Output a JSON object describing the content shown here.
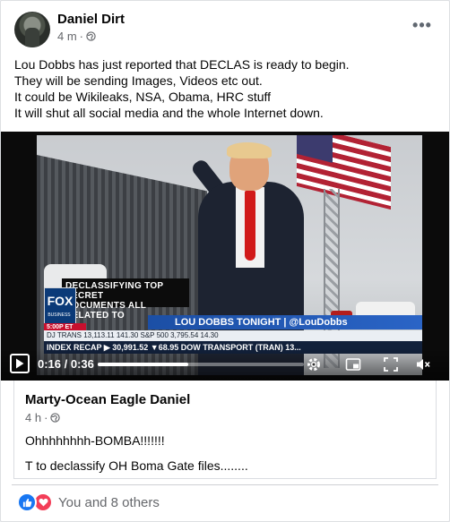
{
  "post": {
    "author": "Daniel Dirt",
    "time": "4 m",
    "separator": "·",
    "more_label": "•••",
    "text_lines": [
      "Lou Dobbs has just reported that DECLAS is ready to begin.",
      "They will be sending Images, Videos etc out.",
      "It could be Wikileaks, NSA, Obama, HRC stuff",
      "It will shut all social media and the whole Internet down."
    ]
  },
  "video": {
    "chyron_tag_line1": "DECLASSIFYING TOP SECRET",
    "chyron_tag_line2": "DOCUMENTS ALL RELATED TO",
    "network_logo": "FOX",
    "network_sub": "BUSINESS",
    "live_time": "5:00P ET",
    "show_bar": "LOU DOBBS TONIGHT | @LouDobbs",
    "ticker_line1": "DJ TRANS 13,113.11  141.30  S&P 500  3,795.54  14.30",
    "ticker_line2": "INDEX RECAP ▶ 30,991.52 ▼68.95  DOW TRANSPORT (TRAN) 13...",
    "time_display": "0:16 / 0:36",
    "progress": 0.44
  },
  "shared": {
    "author": "Marty-Ocean Eagle Daniel",
    "time": "4 h",
    "separator": "·",
    "line1": "Ohhhhhhhh-BOMBA!!!!!!!",
    "line2": "T to declassify OH Boma Gate files........"
  },
  "reactions": {
    "summary": "You and 8 others"
  },
  "icons": {
    "globe": "globe-icon",
    "like": "like-reaction-icon",
    "love": "love-reaction-icon",
    "play": "play-icon",
    "settings": "gear-icon",
    "pip": "picture-in-picture-icon",
    "fullscreen": "fullscreen-icon",
    "volume": "volume-muted-icon"
  },
  "colors": {
    "facebook_blue": "#1877f2",
    "love_red": "#f33e58",
    "secondary_text": "#65676b"
  }
}
